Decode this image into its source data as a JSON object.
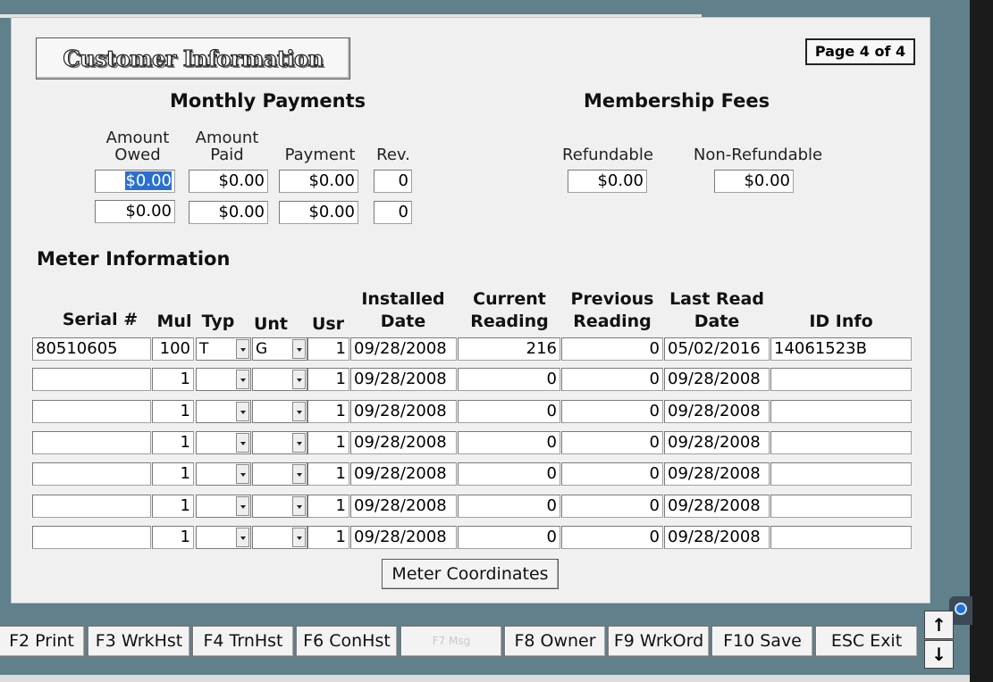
{
  "window": {
    "page_indicator": "Page 4 of 4",
    "title": "Customer Information"
  },
  "monthly_payments": {
    "heading": "Monthly Payments",
    "col_amount_owed": "Amount\nOwed",
    "col_amount_paid": "Amount\nPaid",
    "col_payment": "Payment",
    "col_rev": "Rev.",
    "rows": [
      {
        "owed": "$0.00",
        "paid": "$0.00",
        "payment": "$0.00",
        "rev": "0"
      },
      {
        "owed": "$0.00",
        "paid": "$0.00",
        "payment": "$0.00",
        "rev": "0"
      }
    ]
  },
  "membership_fees": {
    "heading": "Membership Fees",
    "col_refundable": "Refundable",
    "col_non_refundable": "Non-Refundable",
    "refundable": "$0.00",
    "non_refundable": "$0.00"
  },
  "meter_info": {
    "heading": "Meter Information",
    "headers": {
      "serial": "Serial #",
      "mul": "Mul",
      "typ": "Typ",
      "unt": "Unt",
      "usr": "Usr",
      "installed": "Installed\nDate",
      "current": "Current\nReading",
      "previous": "Previous\nReading",
      "last_read": "Last Read\nDate",
      "id_info": "ID Info"
    },
    "rows": [
      {
        "serial": "80510605",
        "mul": "100",
        "typ": "T",
        "unt": "G",
        "usr": "1",
        "installed": "09/28/2008",
        "current": "216",
        "previous": "0",
        "last_read": "05/02/2016",
        "id_info": "14061523B"
      },
      {
        "serial": "",
        "mul": "1",
        "typ": "",
        "unt": "",
        "usr": "1",
        "installed": "09/28/2008",
        "current": "0",
        "previous": "0",
        "last_read": "09/28/2008",
        "id_info": ""
      },
      {
        "serial": "",
        "mul": "1",
        "typ": "",
        "unt": "",
        "usr": "1",
        "installed": "09/28/2008",
        "current": "0",
        "previous": "0",
        "last_read": "09/28/2008",
        "id_info": ""
      },
      {
        "serial": "",
        "mul": "1",
        "typ": "",
        "unt": "",
        "usr": "1",
        "installed": "09/28/2008",
        "current": "0",
        "previous": "0",
        "last_read": "09/28/2008",
        "id_info": ""
      },
      {
        "serial": "",
        "mul": "1",
        "typ": "",
        "unt": "",
        "usr": "1",
        "installed": "09/28/2008",
        "current": "0",
        "previous": "0",
        "last_read": "09/28/2008",
        "id_info": ""
      },
      {
        "serial": "",
        "mul": "1",
        "typ": "",
        "unt": "",
        "usr": "1",
        "installed": "09/28/2008",
        "current": "0",
        "previous": "0",
        "last_read": "09/28/2008",
        "id_info": ""
      },
      {
        "serial": "",
        "mul": "1",
        "typ": "",
        "unt": "",
        "usr": "1",
        "installed": "09/28/2008",
        "current": "0",
        "previous": "0",
        "last_read": "09/28/2008",
        "id_info": ""
      }
    ],
    "coordinates_button": "Meter Coordinates"
  },
  "function_keys": [
    {
      "label": "F2 Print",
      "enabled": true
    },
    {
      "label": "F3 WrkHst",
      "enabled": true
    },
    {
      "label": "F4 TrnHst",
      "enabled": true
    },
    {
      "label": "F6 ConHst",
      "enabled": true
    },
    {
      "label": "F7 Msg",
      "enabled": false
    },
    {
      "label": "F8 Owner",
      "enabled": true
    },
    {
      "label": "F9 WrkOrd",
      "enabled": true
    },
    {
      "label": "F10 Save",
      "enabled": true
    },
    {
      "label": "ESC Exit",
      "enabled": true
    }
  ],
  "scroll": {
    "up_icon": "up-arrow-icon",
    "down_icon": "down-arrow-icon"
  }
}
